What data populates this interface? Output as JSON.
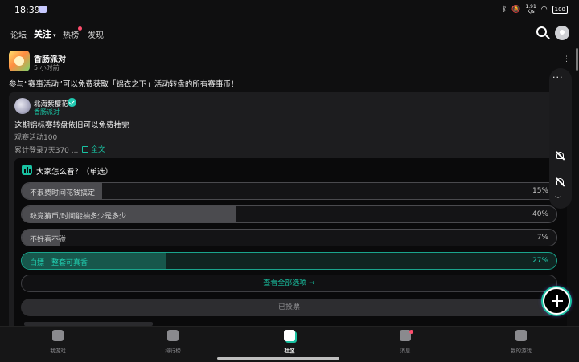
{
  "status_bar": {
    "time": "18:39",
    "net_speed_top": "1.91",
    "net_speed_unit": "K/s",
    "battery": "100"
  },
  "top_nav": {
    "tabs": [
      {
        "label": "论坛"
      },
      {
        "label": "关注",
        "active": true,
        "caret": "▾"
      },
      {
        "label": "热榜",
        "badge": true
      },
      {
        "label": "发现"
      }
    ],
    "icons": [
      "search-icon",
      "avatar"
    ]
  },
  "post": {
    "game_name": "香肠派对",
    "time": "5 小时前",
    "text": "参与“赛事活动”可以免费获取「锦衣之下」活动转盘的所有赛事币！",
    "quoted": {
      "author": "北海紫樱花",
      "sub": "香肠派对",
      "line1": "这期锦标赛转盘依旧可以免费抽完",
      "line2": "观赛活动100",
      "line3": "累计登录7天370 ...",
      "fulltext_label": "全文",
      "poll": {
        "title": "大家怎么看？（单选）",
        "options": [
          {
            "label": "不浪费时间花钱搞定",
            "percent": "15%",
            "value": 0.15,
            "selected": false
          },
          {
            "label": "缺竞猜币/时间能抽多少是多少",
            "percent": "40%",
            "value": 0.4,
            "selected": false
          },
          {
            "label": "不好看不碰",
            "percent": "7%",
            "value": 0.07,
            "selected": false
          },
          {
            "label": "白嫖一整套可真香",
            "percent": "27%",
            "value": 0.27,
            "selected": true
          }
        ],
        "view_all": "查看全部选项 →",
        "voted_label": "已投票"
      }
    }
  },
  "bottom_nav": {
    "items": [
      {
        "label": "我游戏",
        "icon": "controller-icon"
      },
      {
        "label": "排行榜",
        "icon": "ranking-icon"
      },
      {
        "label": "社区",
        "icon": "community-icon",
        "active": true
      },
      {
        "label": "消息",
        "icon": "message-icon",
        "badge": true
      },
      {
        "label": "我的游戏",
        "icon": "my-games-icon"
      }
    ]
  },
  "colors": {
    "accent": "#19c2a2",
    "background": "#0f0f10",
    "badge": "#ff4d6d"
  }
}
